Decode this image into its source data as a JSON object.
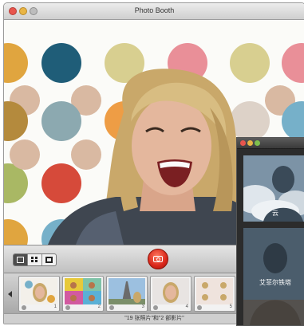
{
  "window": {
    "title": "Photo Booth"
  },
  "effects_panel": {
    "items": [
      {
        "label": "云"
      },
      {
        "label": "艾菲尔铁塔"
      }
    ]
  },
  "controls": {
    "view_buttons": [
      "single-view",
      "four-up-view",
      "filmstrip-view"
    ],
    "shutter_icon": "camera-icon"
  },
  "filmstrip": {
    "thumbnails": [
      {
        "number": "1"
      },
      {
        "number": "2"
      },
      {
        "number": "3"
      },
      {
        "number": "4"
      },
      {
        "number": "5"
      }
    ]
  },
  "status": {
    "text": "\"19 张照片\"和\"2 部影片\""
  },
  "colors": {
    "shutter": "#d9261a",
    "dot_colors": [
      "#e0a53f",
      "#1f5d78",
      "#d8cf90",
      "#d9b9a2",
      "#e98f98",
      "#b48a3d",
      "#d64a3a",
      "#8ca9b0",
      "#76b0c9",
      "#a9b864"
    ]
  }
}
